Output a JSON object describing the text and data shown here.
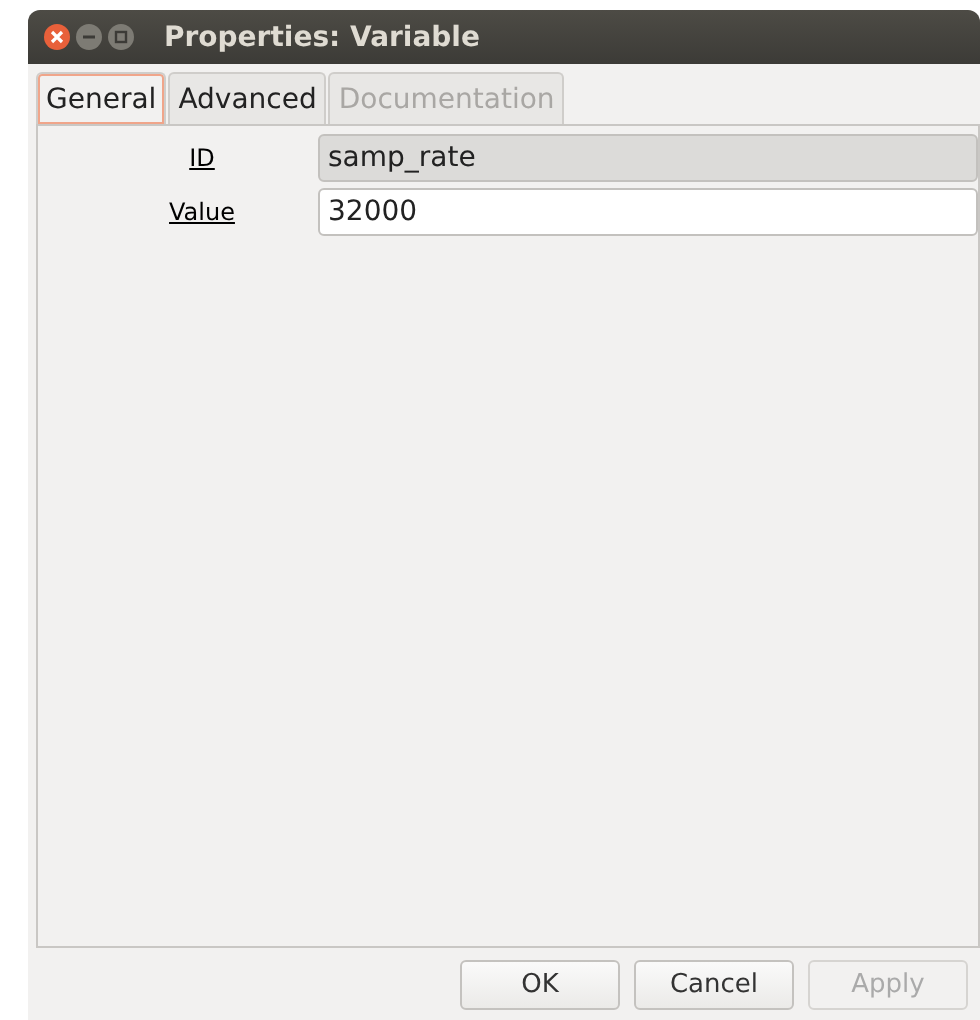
{
  "window": {
    "title": "Properties: Variable"
  },
  "tabs": [
    {
      "label": "General",
      "selected": true,
      "disabled": false
    },
    {
      "label": "Advanced",
      "selected": false,
      "disabled": false
    },
    {
      "label": "Documentation",
      "selected": false,
      "disabled": true
    }
  ],
  "params": [
    {
      "label": "ID",
      "value": "samp_rate",
      "disabled": true
    },
    {
      "label": "Value",
      "value": "32000",
      "disabled": false
    }
  ],
  "buttons": [
    {
      "label": "OK",
      "disabled": false
    },
    {
      "label": "Cancel",
      "disabled": false
    },
    {
      "label": "Apply",
      "disabled": true
    }
  ]
}
